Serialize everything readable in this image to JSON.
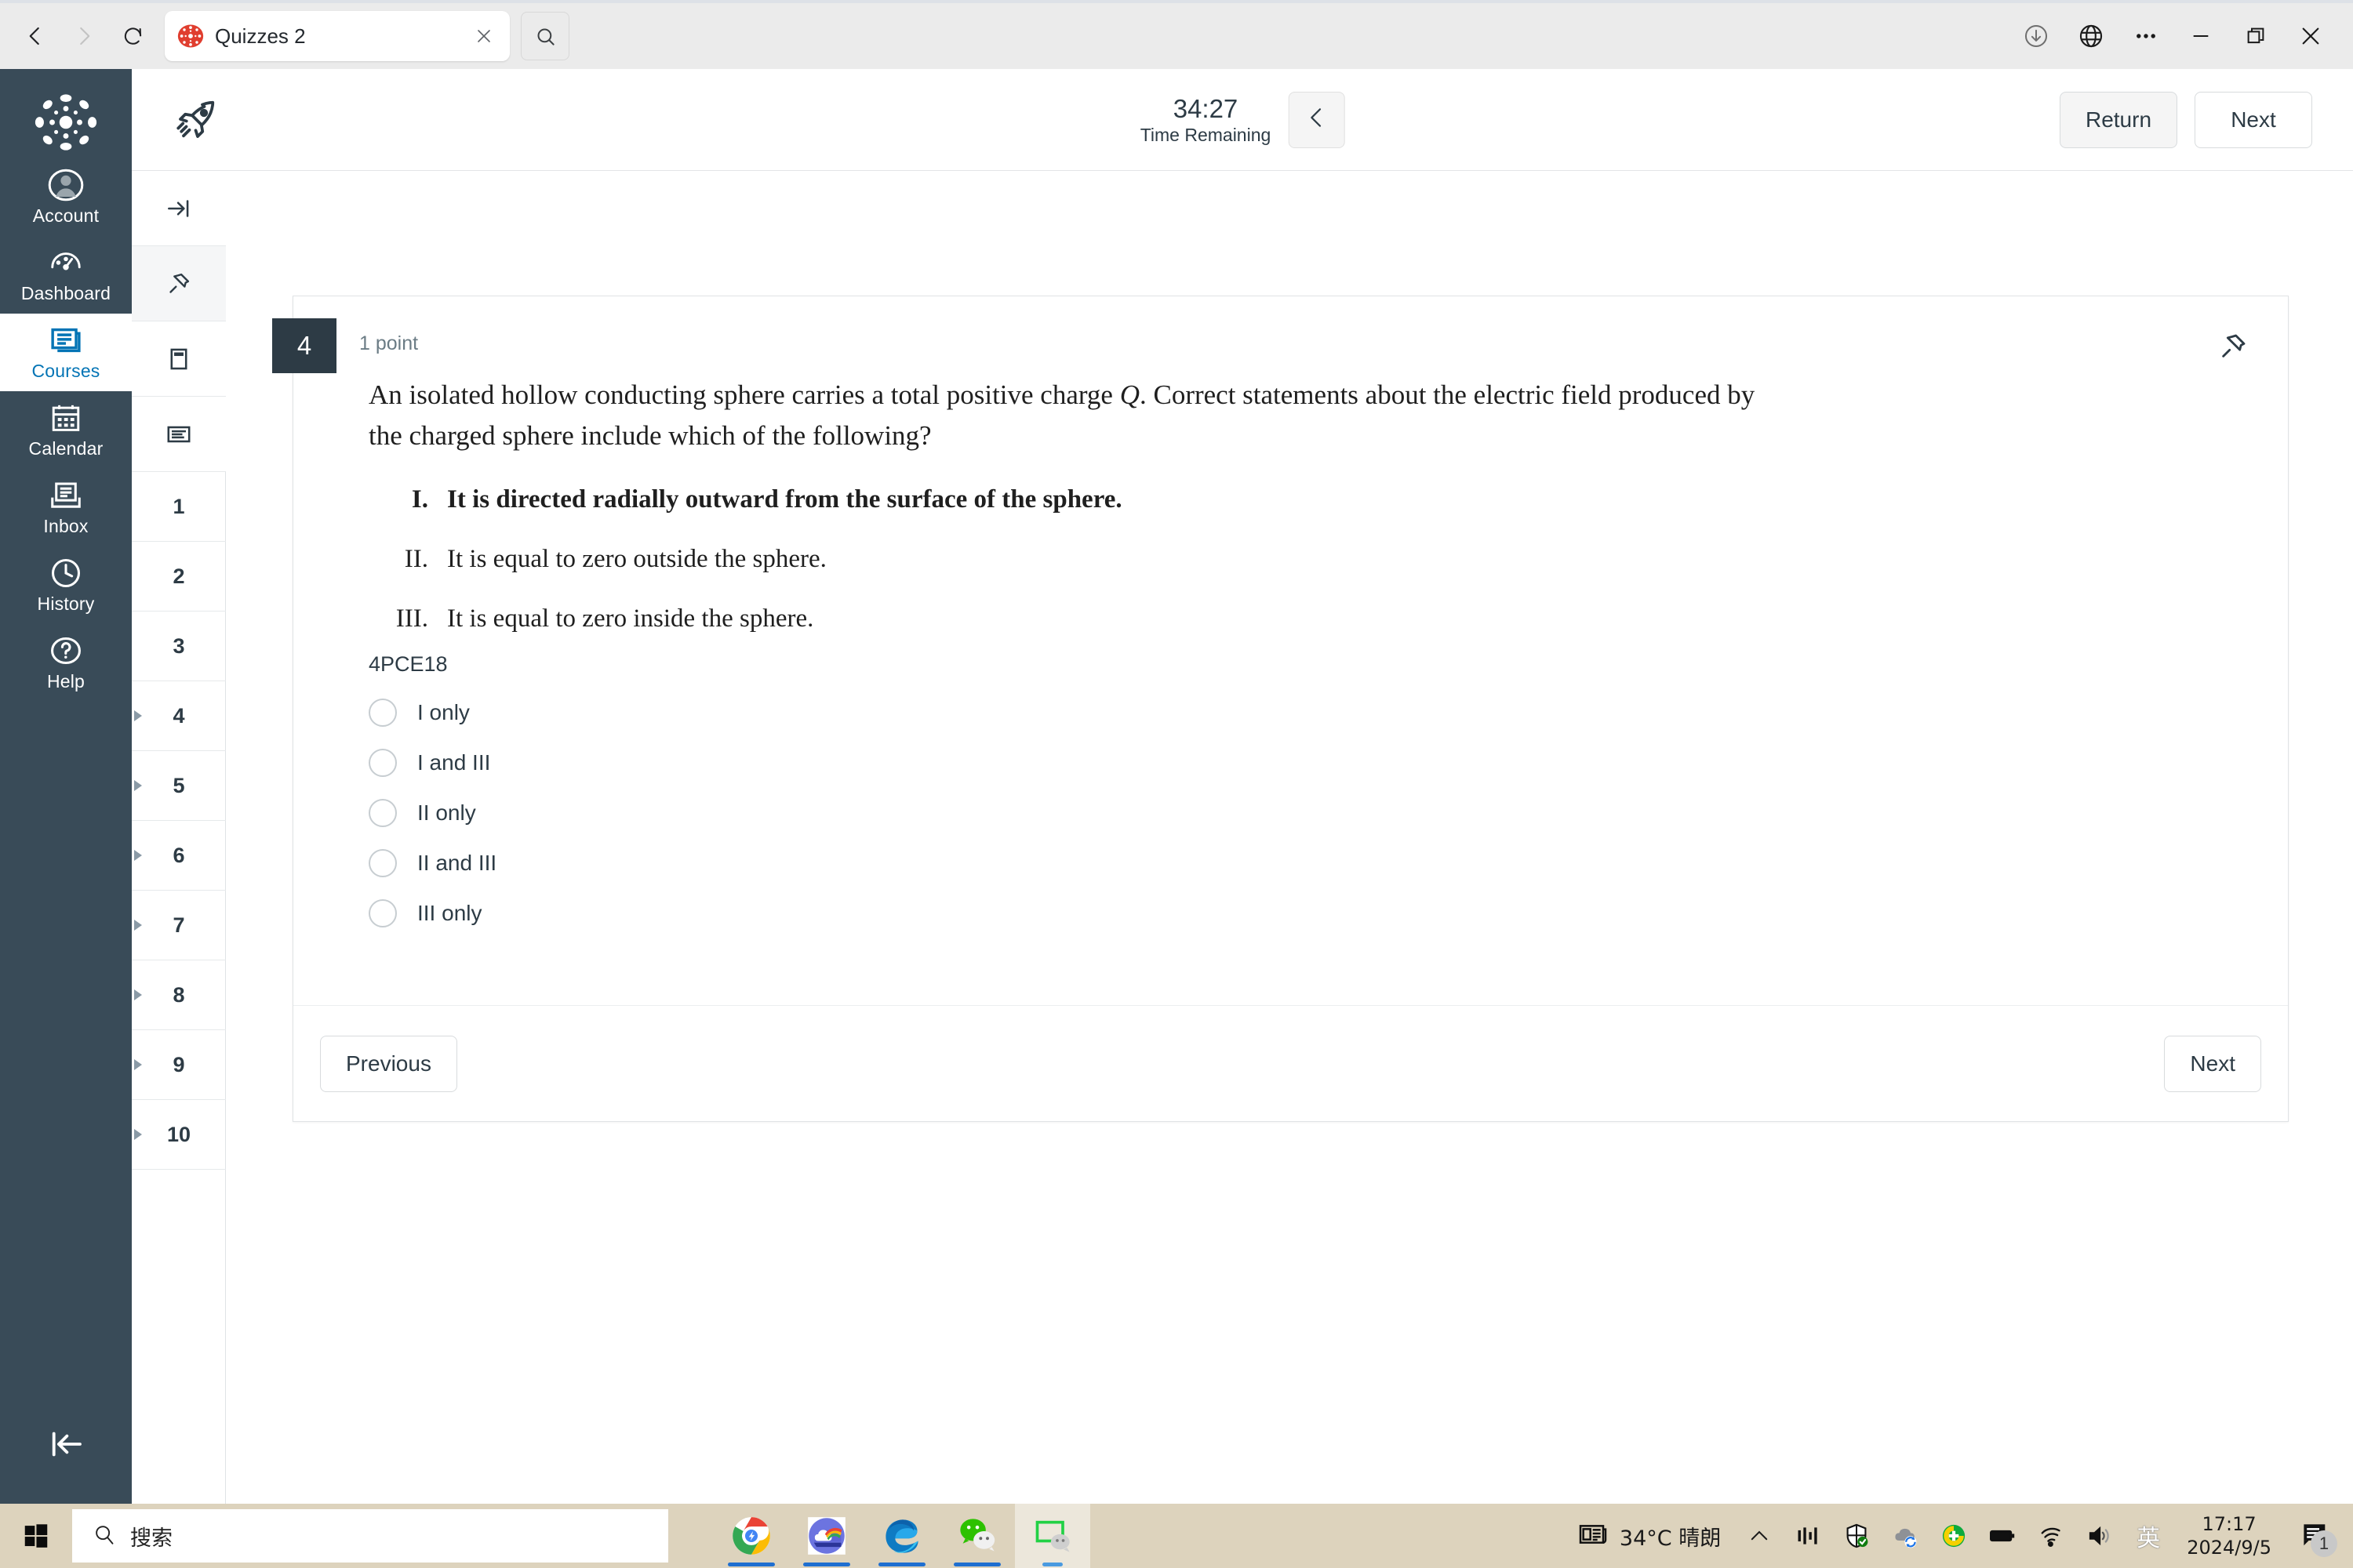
{
  "browser": {
    "back_icon": "back-arrow-icon",
    "forward_icon": "forward-arrow-icon",
    "reload_icon": "reload-icon",
    "tab_title": "Quizzes 2",
    "tab_favicon": "canvas-logo-icon",
    "tab_close_icon": "close-icon",
    "tab_search_icon": "search-icon",
    "controls": {
      "downloads_icon": "download-icon",
      "globe_icon": "globe-icon",
      "more_icon": "more-options-icon",
      "minimize_icon": "minimize-icon",
      "maximize_icon": "maximize-icon",
      "close_icon": "close-icon"
    }
  },
  "sidebar": {
    "logo": "canvas-logo",
    "items": [
      {
        "label": "Account",
        "icon": "user-avatar-icon",
        "active": false
      },
      {
        "label": "Dashboard",
        "icon": "dashboard-gauge-icon",
        "active": false
      },
      {
        "label": "Courses",
        "icon": "courses-book-icon",
        "active": true
      },
      {
        "label": "Calendar",
        "icon": "calendar-icon",
        "active": false
      },
      {
        "label": "Inbox",
        "icon": "inbox-tray-icon",
        "active": false
      },
      {
        "label": "History",
        "icon": "clock-icon",
        "active": false
      },
      {
        "label": "Help",
        "icon": "question-mark-circle-icon",
        "active": false
      }
    ],
    "collapse_icon": "collapse-left-icon"
  },
  "quiz_header": {
    "rocket_icon": "rocket-icon",
    "timer_value": "34:27",
    "timer_label": "Time Remaining",
    "timer_collapse_icon": "chevron-left-icon",
    "return_label": "Return",
    "next_label": "Next"
  },
  "rail": {
    "tools": [
      {
        "icon": "expand-right-icon",
        "shaded": false
      },
      {
        "icon": "pin-icon",
        "shaded": true
      },
      {
        "icon": "page-header-icon",
        "shaded": false
      },
      {
        "icon": "text-lines-icon",
        "shaded": false
      }
    ],
    "questions": [
      {
        "number": "1",
        "flagged": false
      },
      {
        "number": "2",
        "flagged": false
      },
      {
        "number": "3",
        "flagged": false
      },
      {
        "number": "4",
        "flagged": true
      },
      {
        "number": "5",
        "flagged": true
      },
      {
        "number": "6",
        "flagged": true
      },
      {
        "number": "7",
        "flagged": true
      },
      {
        "number": "8",
        "flagged": true
      },
      {
        "number": "9",
        "flagged": true
      },
      {
        "number": "10",
        "flagged": true
      }
    ]
  },
  "question": {
    "number": "4",
    "points": "1 point",
    "pin_icon": "pin-icon",
    "stem_part1": "An isolated hollow conducting sphere carries a total positive charge ",
    "stem_charge": "Q",
    "stem_part2": ". Correct statements about the electric field produced by the charged sphere include which of the following?",
    "statements": [
      {
        "numeral": "I.",
        "text": "It is directed radially outward from the surface of the sphere.",
        "bold": true
      },
      {
        "numeral": "II.",
        "text": "It is equal to zero outside the sphere.",
        "bold": false
      },
      {
        "numeral": "III.",
        "text": "It is equal to zero inside the sphere.",
        "bold": false
      }
    ],
    "code": "4PCE18",
    "answers": [
      {
        "label": "I only",
        "selected": false
      },
      {
        "label": "I and III",
        "selected": false
      },
      {
        "label": "II only",
        "selected": false
      },
      {
        "label": "II and III",
        "selected": false
      },
      {
        "label": "III only",
        "selected": false
      }
    ],
    "previous_label": "Previous",
    "next_label": "Next"
  },
  "taskbar": {
    "start_icon": "windows-start-icon",
    "search_icon": "search-icon",
    "search_placeholder": "搜索",
    "apps": [
      {
        "name": "chrome-icon",
        "active": false
      },
      {
        "name": "weather-cloud-icon",
        "active": false
      },
      {
        "name": "edge-icon",
        "active": false
      },
      {
        "name": "wechat-icon",
        "active": false
      },
      {
        "name": "wechat-window-icon",
        "active": true
      }
    ],
    "weather_temp": "34°C",
    "weather_desc": "晴朗",
    "weather_icon": "news-weather-icon",
    "tray": [
      {
        "name": "show-hidden-icons-chevron"
      },
      {
        "name": "network-monitor-icon"
      },
      {
        "name": "security-shield-icon"
      },
      {
        "name": "onedrive-sync-icon"
      },
      {
        "name": "update-icon"
      },
      {
        "name": "battery-icon"
      },
      {
        "name": "wifi-icon"
      },
      {
        "name": "volume-icon"
      }
    ],
    "ime_label": "英",
    "clock_time": "17:17",
    "clock_date": "2024/9/5",
    "notification_count": "1",
    "notification_icon": "notification-icon"
  },
  "colors": {
    "canvas_navy": "#394B58",
    "canvas_blue": "#0374B5",
    "badge_dark": "#2D3B45",
    "taskbar": "#ddd3bd"
  }
}
